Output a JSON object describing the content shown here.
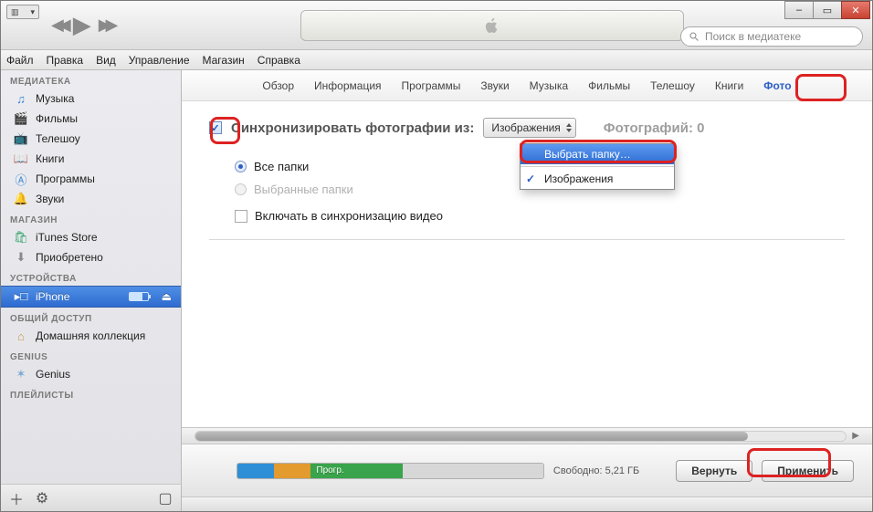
{
  "window": {
    "min": "–",
    "max": "▭",
    "close": "✕"
  },
  "search": {
    "placeholder": "Поиск в медиатеке"
  },
  "menubar": [
    "Файл",
    "Правка",
    "Вид",
    "Управление",
    "Магазин",
    "Справка"
  ],
  "sidebar": {
    "sections": [
      {
        "title": "МЕДИАТЕКА",
        "items": [
          {
            "icon": "♫",
            "color": "#3b82d6",
            "label": "Музыка"
          },
          {
            "icon": "🎬",
            "color": "#4a6fa0",
            "label": "Фильмы"
          },
          {
            "icon": "📺",
            "color": "#3aa0d8",
            "label": "Телешоу"
          },
          {
            "icon": "📖",
            "color": "#c79a4e",
            "label": "Книги"
          },
          {
            "icon": "Ⓐ",
            "color": "#3a88d6",
            "label": "Программы"
          },
          {
            "icon": "🔔",
            "color": "#d6a63a",
            "label": "Звуки"
          }
        ]
      },
      {
        "title": "МАГАЗИН",
        "items": [
          {
            "icon": "🛍",
            "color": "#35a46a",
            "label": "iTunes Store"
          },
          {
            "icon": "⬇",
            "color": "#8a8a8a",
            "label": "Приобретено"
          }
        ]
      },
      {
        "title": "УСТРОЙСТВА",
        "items": [
          {
            "icon": "▸□",
            "color": "#ffffff",
            "label": "iPhone",
            "selected": true,
            "battery": true,
            "eject": true
          }
        ]
      },
      {
        "title": "ОБЩИЙ ДОСТУП",
        "items": [
          {
            "icon": "⌂",
            "color": "#c79a4e",
            "label": "Домашняя коллекция"
          }
        ]
      },
      {
        "title": "GENIUS",
        "items": [
          {
            "icon": "✶",
            "color": "#7aa6d6",
            "label": "Genius"
          }
        ]
      },
      {
        "title": "ПЛЕЙЛИСТЫ",
        "items": []
      }
    ]
  },
  "tabs": [
    "Обзор",
    "Информация",
    "Программы",
    "Звуки",
    "Музыка",
    "Фильмы",
    "Телешоу",
    "Книги",
    "Фото"
  ],
  "active_tab": 8,
  "sync": {
    "checkbox_checked": true,
    "label": "Синхронизировать фотографии из:",
    "source": "Изображения",
    "count_label": "Фотографий:",
    "count": "0",
    "radio_all": "Все папки",
    "radio_sel": "Выбранные папки",
    "include_video": "Включать в синхронизацию видео"
  },
  "dropdown": {
    "choose": "Выбрать папку…",
    "pictures": "Изображения"
  },
  "capacity": {
    "segments": [
      {
        "color": "#2e8fd6",
        "width": "12%",
        "label": ""
      },
      {
        "color": "#e39a2e",
        "width": "12%",
        "label": ""
      },
      {
        "color": "#39a44b",
        "width": "30%",
        "label": "Прогр."
      },
      {
        "color": "#d7d7d7",
        "width": "46%",
        "label": ""
      }
    ],
    "free": "Свободно: 5,21 ГБ"
  },
  "buttons": {
    "revert": "Вернуть",
    "apply": "Применить"
  }
}
